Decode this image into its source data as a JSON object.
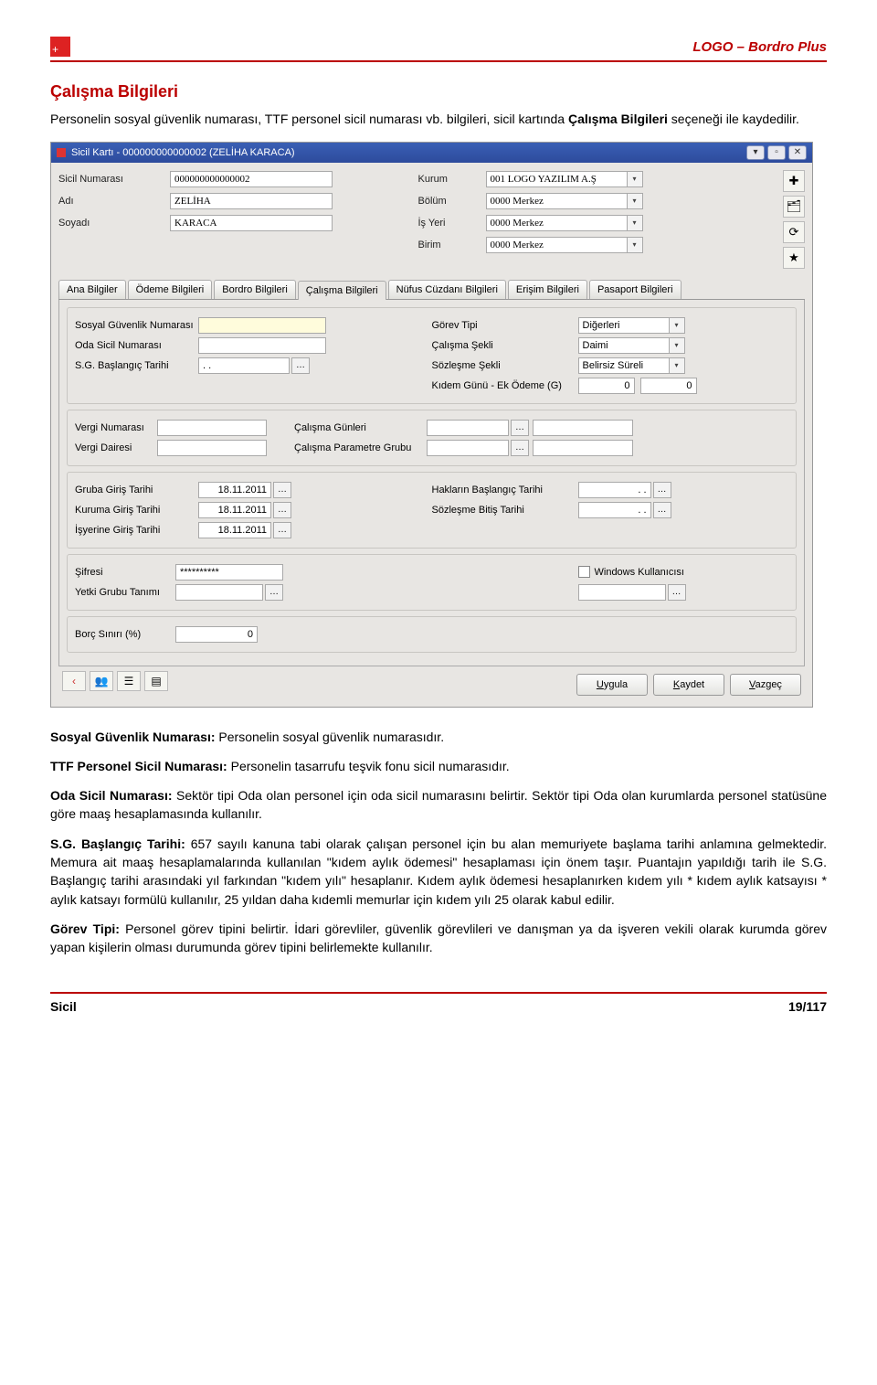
{
  "header": {
    "plus": "+",
    "brand": "LOGO – Bordro Plus"
  },
  "section_title": "Çalışma Bilgileri",
  "intro_pre": "Personelin sosyal güvenlik numarası, TTF personel sicil numarası vb. bilgileri, sicil kartında ",
  "intro_bold": "Çalışma Bilgileri",
  "intro_post": " seçeneği ile kaydedilir.",
  "app": {
    "title": "Sicil Kartı - 000000000000002 (ZELİHA KARACA)",
    "top": {
      "sicil_no_label": "Sicil Numarası",
      "sicil_no": "000000000000002",
      "adi_label": "Adı",
      "adi": "ZELİHA",
      "soyadi_label": "Soyadı",
      "soyadi": "KARACA",
      "kurum_label": "Kurum",
      "kurum": "001 LOGO YAZILIM A.Ş",
      "bolum_label": "Bölüm",
      "bolum": "0000 Merkez",
      "isyeri_label": "İş Yeri",
      "isyeri": "0000 Merkez",
      "birim_label": "Birim",
      "birim": "0000 Merkez"
    },
    "tabs": [
      "Ana Bilgiler",
      "Ödeme Bilgileri",
      "Bordro Bilgileri",
      "Çalışma Bilgileri",
      "Nüfus Cüzdanı Bilgileri",
      "Erişim Bilgileri",
      "Pasaport Bilgileri"
    ],
    "g1": {
      "sgn_label": "Sosyal Güvenlik Numarası",
      "osn_label": "Oda Sicil Numarası",
      "sgb_label": "S.G. Başlangıç Tarihi",
      "sgb_val": ". .",
      "gt_label": "Görev Tipi",
      "gt_val": "Diğerleri",
      "cs_label": "Çalışma Şekli",
      "cs_val": "Daimi",
      "ss_label": "Sözleşme Şekli",
      "ss_val": "Belirsiz Süreli",
      "kg_label": "Kıdem Günü - Ek Ödeme (G)",
      "kg_v1": "0",
      "kg_v2": "0"
    },
    "g2": {
      "vn_label": "Vergi Numarası",
      "vd_label": "Vergi Dairesi",
      "cg_label": "Çalışma Günleri",
      "cpg_label": "Çalışma Parametre Grubu"
    },
    "g3": {
      "ggt_label": "Gruba Giriş Tarihi",
      "ggt_val": "18.11.2011",
      "kgt_label": "Kuruma Giriş Tarihi",
      "kgt_val": "18.11.2011",
      "igt_label": "İşyerine Giriş Tarihi",
      "igt_val": "18.11.2011",
      "hbt_label": "Hakların Başlangıç Tarihi",
      "hbt_val": ". .",
      "sbt_label": "Sözleşme Bitiş Tarihi",
      "sbt_val": ". ."
    },
    "g4": {
      "sif_label": "Şifresi",
      "sif_val": "**********",
      "ygt_label": "Yetki Grubu Tanımı",
      "wk_label": "Windows Kullanıcısı"
    },
    "g5": {
      "bs_label": "Borç Sınırı (%)",
      "bs_val": "0"
    },
    "buttons": {
      "apply": "Uygula",
      "save": "Kaydet",
      "cancel": "Vazgeç"
    }
  },
  "paras": {
    "p1b": "Sosyal Güvenlik Numarası: ",
    "p1": "Personelin sosyal güvenlik numarasıdır.",
    "p2b": "TTF Personel Sicil Numarası: ",
    "p2": "Personelin tasarrufu teşvik fonu sicil numarasıdır.",
    "p3b": "Oda Sicil Numarası: ",
    "p3": "Sektör tipi Oda olan personel için oda sicil numarasını belirtir. Sektör tipi Oda olan kurumlarda personel statüsüne göre maaş hesaplamasında kullanılır.",
    "p4b": "S.G. Başlangıç Tarihi: ",
    "p4": "657 sayılı kanuna tabi olarak çalışan personel için bu alan memuriyete başlama tarihi anlamına gelmektedir. Memura ait maaş hesaplamalarında kullanılan \"kıdem aylık ödemesi\" hesaplaması için önem taşır. Puantajın yapıldığı tarih ile S.G. Başlangıç tarihi arasındaki yıl farkından \"kıdem yılı\" hesaplanır. Kıdem aylık ödemesi hesaplanırken kıdem yılı * kıdem aylık katsayısı * aylık katsayı formülü kullanılır, 25 yıldan daha kıdemli memurlar için kıdem yılı 25 olarak kabul edilir.",
    "p5b": "Görev Tipi: ",
    "p5": "Personel görev tipini belirtir. İdari görevliler, güvenlik görevlileri ve danışman ya da işveren vekili olarak kurumda görev yapan kişilerin olması durumunda görev tipini belirlemekte kullanılır."
  },
  "footer": {
    "left": "Sicil",
    "right": "19/117"
  }
}
